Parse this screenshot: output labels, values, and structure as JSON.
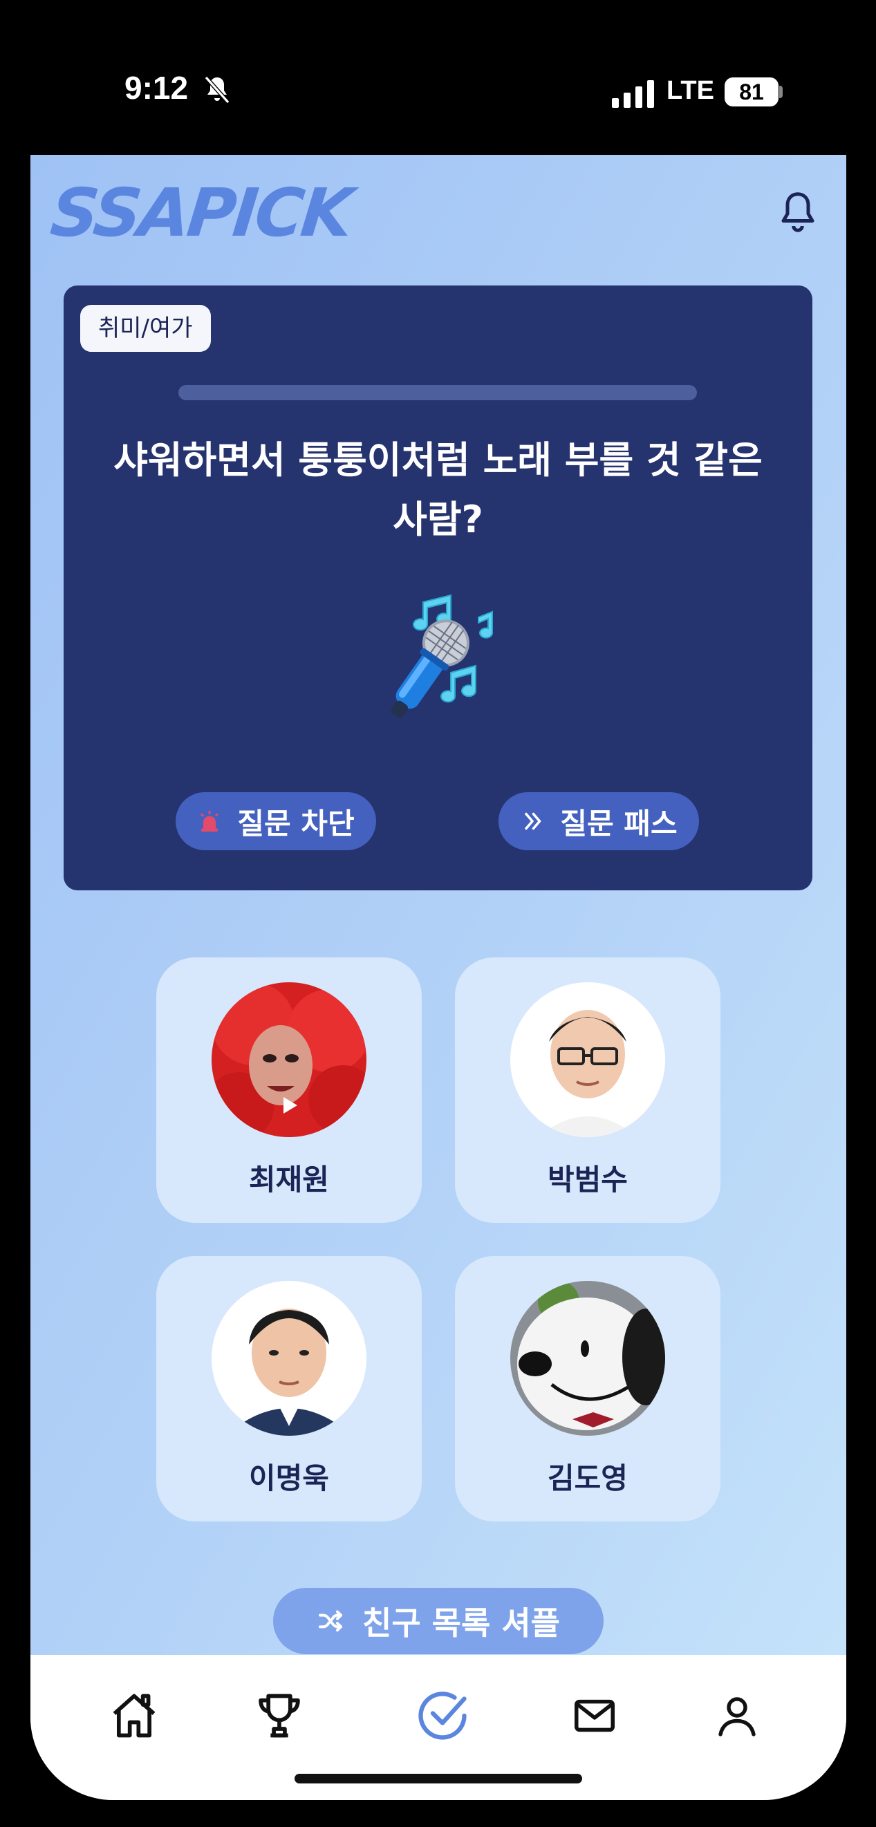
{
  "status_bar": {
    "time": "9:12",
    "network": "LTE",
    "battery": "81"
  },
  "app": {
    "logo": "SSAPICK"
  },
  "question_card": {
    "category": "취미/여가",
    "question": "샤워하면서 퉁퉁이처럼 노래 부를 것 같은 사람?",
    "block_label": "질문 차단",
    "pass_label": "질문 패스",
    "progress": 0
  },
  "friends": [
    {
      "name": "최재원"
    },
    {
      "name": "박범수"
    },
    {
      "name": "이명욱"
    },
    {
      "name": "김도영"
    }
  ],
  "shuffle_label": "친구 목록 셔플",
  "colors": {
    "primary": "#25336f",
    "accent": "#5b86e0",
    "button": "#4461c0",
    "background": "#b3d2f7"
  },
  "tabs": [
    "home-icon",
    "trophy-icon",
    "vote-check-icon",
    "mail-icon",
    "profile-icon"
  ]
}
